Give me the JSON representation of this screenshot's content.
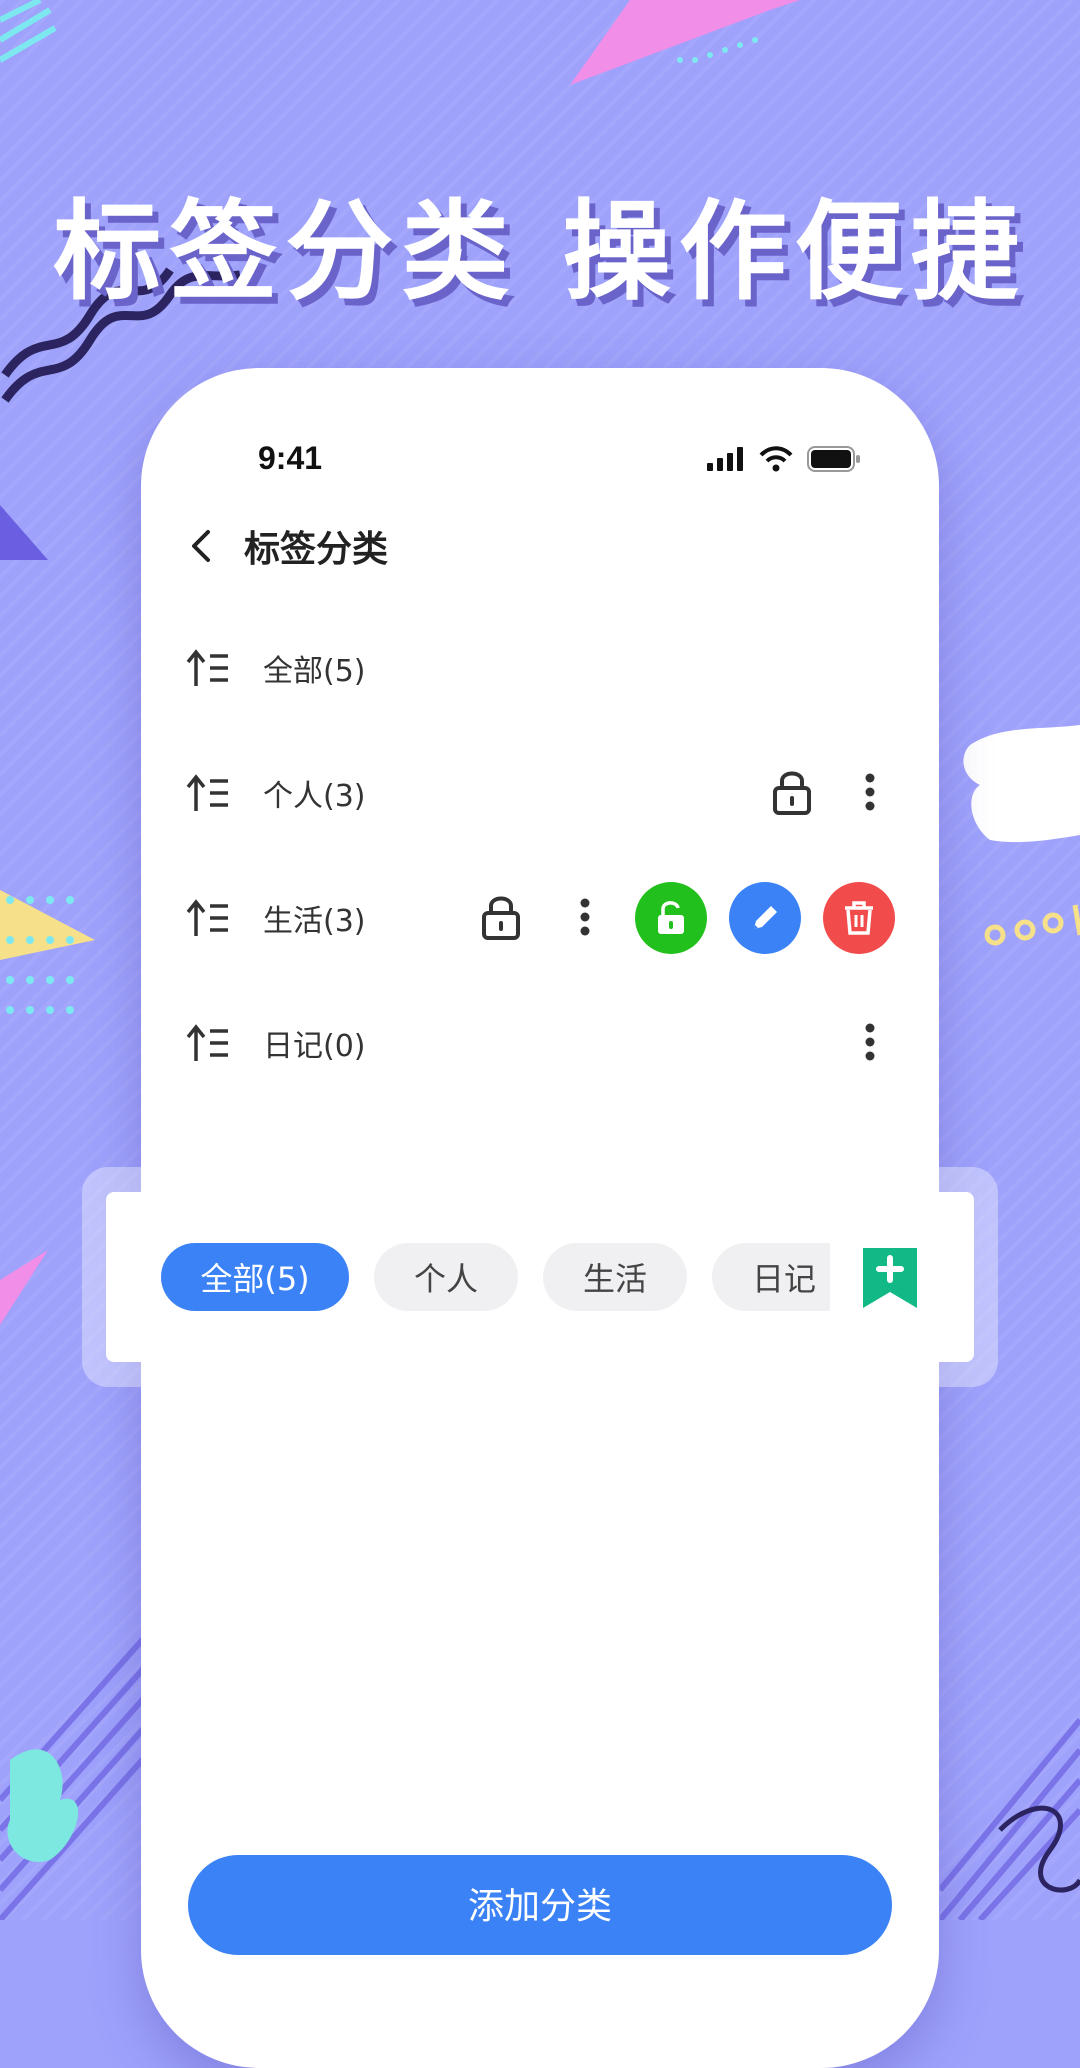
{
  "headline": "标签分类  操作便捷",
  "status": {
    "time": "9:41"
  },
  "nav": {
    "title": "标签分类",
    "back_icon": "chevron-left-icon"
  },
  "categories": [
    {
      "label": "全部(5)"
    },
    {
      "label": "个人(3)"
    },
    {
      "label": "生活(3)"
    },
    {
      "label": "日记(0)"
    }
  ],
  "tabs": [
    {
      "label": "全部(5)",
      "active": true
    },
    {
      "label": "个人"
    },
    {
      "label": "生活"
    },
    {
      "label": "日记"
    }
  ],
  "add_button": {
    "label": "添加分类"
  },
  "colors": {
    "background": "#9ea2fb",
    "accent": "#3b82f6",
    "unlock_green": "#22c01c",
    "edit_blue": "#3b82f6",
    "delete_red": "#f24b4b",
    "bookmark_teal": "#12b886"
  }
}
